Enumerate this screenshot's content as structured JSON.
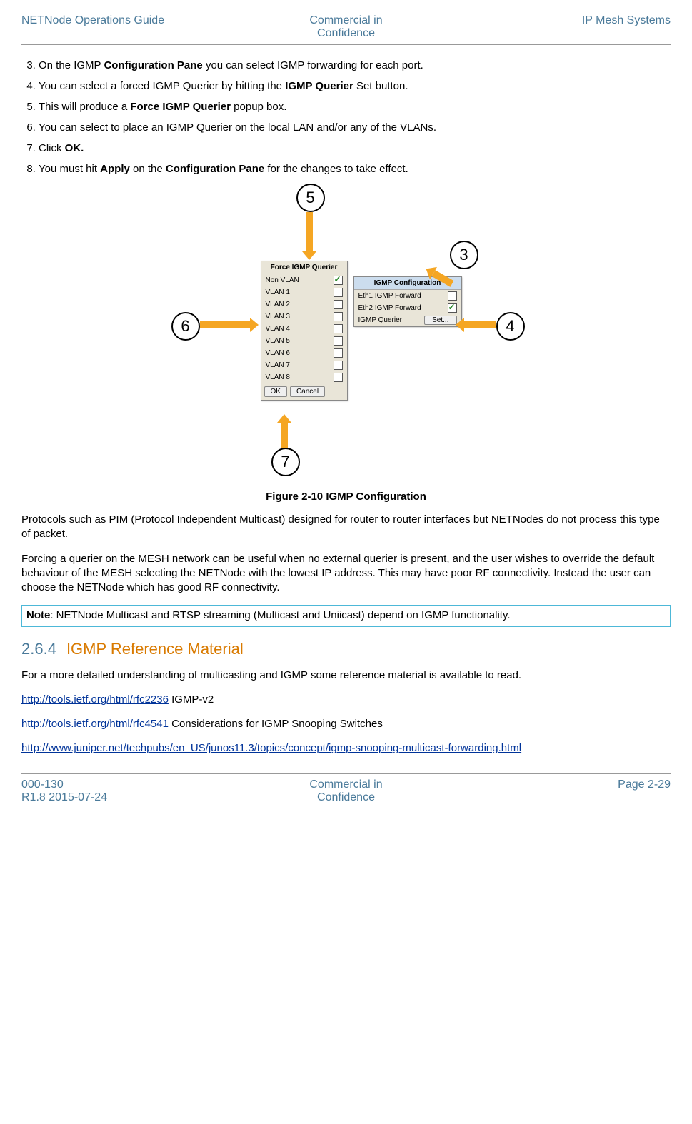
{
  "header": {
    "left": "NETNode Operations Guide",
    "center_l1": "Commercial in",
    "center_l2": "Confidence",
    "right": "IP Mesh Systems"
  },
  "steps": {
    "s3_a": "On the IGMP ",
    "s3_b": "Configuration Pane",
    "s3_c": " you can select IGMP forwarding for each port.",
    "s4_a": "You can select a forced IGMP Querier by hitting the ",
    "s4_b": "IGMP Querier",
    "s4_c": " Set button.",
    "s5_a": "This will produce a ",
    "s5_b": "Force IGMP Querier",
    "s5_c": " popup box.",
    "s6": "You can select to place an IGMP Querier on the local LAN and/or any of the VLANs.",
    "s7_a": "Click ",
    "s7_b": "OK.",
    "s8_a": "You must hit ",
    "s8_b": "Apply",
    "s8_c": " on the ",
    "s8_d": "Configuration Pane",
    "s8_e": " for the changes to take effect."
  },
  "figure": {
    "bubble3": "3",
    "bubble4": "4",
    "bubble5": "5",
    "bubble6": "6",
    "bubble7": "7",
    "force_title": "Force IGMP Querier",
    "rows": [
      {
        "label": "Non VLAN",
        "checked": true
      },
      {
        "label": "VLAN 1",
        "checked": false
      },
      {
        "label": "VLAN 2",
        "checked": false
      },
      {
        "label": "VLAN 3",
        "checked": false
      },
      {
        "label": "VLAN 4",
        "checked": false
      },
      {
        "label": "VLAN 5",
        "checked": false
      },
      {
        "label": "VLAN 6",
        "checked": false
      },
      {
        "label": "VLAN 7",
        "checked": false
      },
      {
        "label": "VLAN 8",
        "checked": false
      }
    ],
    "ok": "OK",
    "cancel": "Cancel",
    "igmp_title": "IGMP Configuration",
    "eth1": "Eth1 IGMP Forward",
    "eth2": "Eth2 IGMP Forward",
    "querier_label": "IGMP Querier",
    "set": "Set...",
    "caption": "Figure 2-10 IGMP Configuration"
  },
  "body": {
    "p1": "Protocols such as PIM (Protocol Independent Multicast) designed for router to router interfaces but NETNodes do not process this type of packet.",
    "p2": "Forcing a querier on the MESH network can be useful when no external querier is present, and the user wishes to override the default behaviour of the MESH selecting the NETNode with the lowest IP address. This may have poor RF connectivity. Instead the user can choose the NETNode which has good RF connectivity.",
    "note_b": "Note",
    "note_t": ": NETNode Multicast and RTSP streaming (Multicast and Uniicast) depend on IGMP functionality."
  },
  "section": {
    "num": "2.6.4",
    "title": "IGMP Reference Material",
    "intro": "For a more detailed understanding of multicasting and IGMP some reference material is available to read.",
    "l1_url": "http://tools.ietf.org/html/rfc2236",
    "l1_txt": " IGMP-v2",
    "l2_url": "http://tools.ietf.org/html/rfc4541",
    "l2_txt": " Considerations for IGMP Snooping Switches",
    "l3_url": "http://www.juniper.net/techpubs/en_US/junos11.3/topics/concept/igmp-snooping-multicast-forwarding.html"
  },
  "footer": {
    "left_l1": "000-130",
    "left_l2": "R1.8 2015-07-24",
    "center_l1": "Commercial in",
    "center_l2": "Confidence",
    "right": "Page 2-29"
  }
}
